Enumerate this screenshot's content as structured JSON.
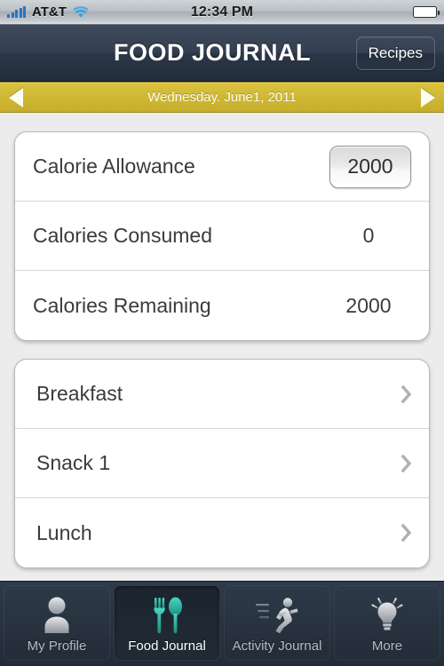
{
  "status_bar": {
    "carrier": "AT&T",
    "time": "12:34 PM",
    "signal_icon": "signal-bars-icon",
    "wifi_icon": "wifi-icon",
    "battery_icon": "battery-icon"
  },
  "nav": {
    "title": "FOOD JOURNAL",
    "recipes_label": "Recipes"
  },
  "date_bar": {
    "date": "Wednesday. June1, 2011",
    "prev_icon": "triangle-left-icon",
    "next_icon": "triangle-right-icon",
    "accent": "#cfb734"
  },
  "summary": {
    "rows": [
      {
        "label": "Calorie Allowance",
        "value": "2000",
        "editable": true
      },
      {
        "label": "Calories Consumed",
        "value": "0",
        "editable": false
      },
      {
        "label": "Calories Remaining",
        "value": "2000",
        "editable": false
      }
    ]
  },
  "meals": {
    "items": [
      {
        "label": "Breakfast"
      },
      {
        "label": "Snack 1"
      },
      {
        "label": "Lunch"
      }
    ],
    "chevron_icon": "chevron-right-icon"
  },
  "tab_bar": {
    "active_color": "#2fb3a3",
    "tabs": [
      {
        "label": "My Profile",
        "icon": "person-icon",
        "active": false
      },
      {
        "label": "Food Journal",
        "icon": "utensils-icon",
        "active": true
      },
      {
        "label": "Activity Journal",
        "icon": "runner-icon",
        "active": false
      },
      {
        "label": "More",
        "icon": "lightbulb-icon",
        "active": false
      }
    ]
  }
}
